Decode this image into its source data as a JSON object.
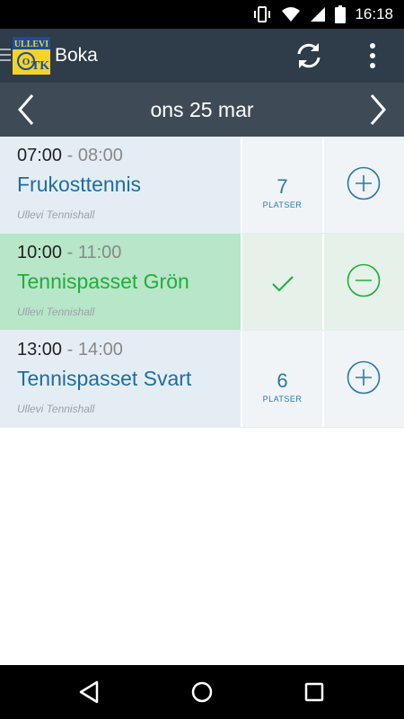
{
  "status_bar": {
    "time": "16:18",
    "icons": [
      "vibrate-icon",
      "wifi-icon",
      "signal-icon",
      "battery-icon"
    ]
  },
  "app_bar": {
    "title": "Boka",
    "logo_text": "ULLEVI OTK",
    "actions": [
      "refresh-icon",
      "more-vert-icon"
    ]
  },
  "date_bar": {
    "date": "ons 25 mar"
  },
  "sessions": [
    {
      "start": "07:00",
      "separator": "-",
      "end": "08:00",
      "name": "Frukosttennis",
      "venue": "Ullevi Tennishall",
      "spots": "7",
      "spots_unit": "PLATSER",
      "state": "available",
      "action_icon": "add-circle-icon"
    },
    {
      "start": "10:00",
      "separator": "-",
      "end": "11:00",
      "name": "Tennispasset Grön",
      "venue": "Ullevi Tennishall",
      "state": "booked",
      "status_icon": "check-icon",
      "action_icon": "remove-circle-icon"
    },
    {
      "start": "13:00",
      "separator": "-",
      "end": "14:00",
      "name": "Tennispasset Svart",
      "venue": "Ullevi Tennishall",
      "spots": "6",
      "spots_unit": "PLATSER",
      "state": "available",
      "action_icon": "add-circle-icon"
    }
  ],
  "colors": {
    "app_bar": "#2f3c49",
    "date_bar": "#3e4b57",
    "accent_blue": "#1f6d9e",
    "booked_green": "#1fae3a"
  },
  "nav_bar": {
    "buttons": [
      "back-icon",
      "home-icon",
      "recents-icon"
    ]
  }
}
